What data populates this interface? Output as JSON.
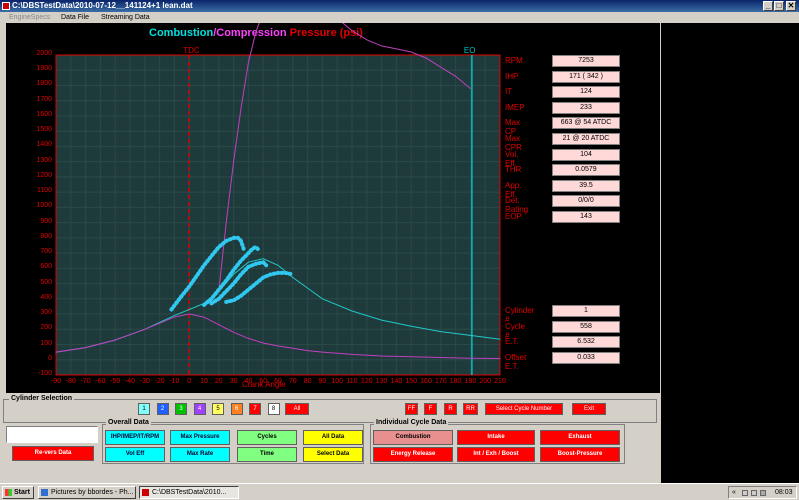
{
  "window": {
    "title": "C:\\DBSTestData\\2010-07-12__141124+1 lean.dat",
    "minimize": "_",
    "maximize": "□",
    "close": "✕"
  },
  "menu": {
    "items": [
      {
        "label": "EngineSpecs",
        "disabled": true
      },
      {
        "label": "Data File",
        "disabled": false
      },
      {
        "label": "Streaming Data",
        "disabled": false
      }
    ]
  },
  "chart": {
    "title_part1": "Combustion",
    "title_sep": "/",
    "title_part2": "Compression",
    "title_part3": "Pressure (psi)",
    "marker_tdc": "TDC",
    "marker_eo": "EO",
    "xlabel": "Crank Angle"
  },
  "colors": {
    "title_cyan": "#00e0e0",
    "title_magenta": "#ff40ff",
    "axis_red": "#e00000",
    "grid": "#2a4a4a",
    "plot_bg": "#1f3a3a",
    "combustion_trace": "#20c8c8",
    "compression_trace": "#c040c0",
    "highlight": "#30c8f0",
    "readout_bg": "#ffd8d8"
  },
  "chart_data": {
    "type": "line",
    "xlabel": "Crank Angle",
    "ylabel": "",
    "xlim": [
      -90,
      210
    ],
    "ylim": [
      -100,
      2000
    ],
    "x_ticks": [
      -90,
      -80,
      -70,
      -60,
      -50,
      -40,
      -30,
      -20,
      -10,
      0,
      10,
      20,
      30,
      40,
      50,
      60,
      70,
      80,
      90,
      100,
      110,
      120,
      130,
      140,
      150,
      160,
      170,
      180,
      190,
      200,
      210
    ],
    "y_ticks": [
      2000,
      1900,
      1800,
      1700,
      1600,
      1500,
      1400,
      1300,
      1200,
      1100,
      1000,
      900,
      800,
      700,
      600,
      500,
      400,
      300,
      200,
      100,
      0,
      -100
    ],
    "markers": [
      {
        "label": "TDC",
        "x": 0
      },
      {
        "label": "EO",
        "x": 191
      }
    ],
    "series": [
      {
        "key": "combustion",
        "x": [
          -90,
          -70,
          -50,
          -30,
          -10,
          0,
          10,
          20,
          30,
          40,
          50,
          60,
          70,
          80,
          90,
          110,
          130,
          150,
          170,
          190,
          210
        ],
        "y": [
          50,
          80,
          130,
          200,
          290,
          330,
          370,
          450,
          560,
          640,
          663,
          620,
          540,
          470,
          400,
          320,
          260,
          220,
          185,
          160,
          135
        ]
      },
      {
        "key": "compression",
        "x": [
          -90,
          -70,
          -50,
          -30,
          -10,
          0,
          10,
          20,
          30,
          40,
          50,
          60,
          70,
          80,
          90,
          110,
          130,
          150,
          170,
          190,
          210
        ],
        "y": [
          50,
          80,
          130,
          200,
          280,
          300,
          280,
          230,
          180,
          140,
          110,
          90,
          75,
          60,
          50,
          35,
          25,
          20,
          15,
          10,
          8
        ]
      },
      {
        "key": "rise_trace",
        "x": [
          20,
          25,
          30,
          35,
          40,
          45,
          50,
          55,
          60,
          70,
          80,
          90,
          100,
          110,
          120,
          130,
          140,
          150,
          160,
          170,
          180,
          190
        ],
        "y": [
          450,
          900,
          1300,
          1650,
          1950,
          2150,
          2280,
          2330,
          2340,
          2350,
          2360,
          2320,
          2240,
          2160,
          2100,
          2060,
          2040,
          2020,
          1980,
          1920,
          1860,
          1780
        ]
      },
      {
        "key": "highlight_1",
        "x": [
          -12,
          -5,
          0,
          5,
          10,
          15,
          20,
          25,
          30,
          33,
          35,
          37
        ],
        "y": [
          330,
          420,
          480,
          550,
          620,
          680,
          740,
          780,
          800,
          800,
          780,
          720
        ]
      },
      {
        "key": "highlight_2",
        "x": [
          10,
          15,
          20,
          25,
          30,
          35,
          40,
          43,
          45,
          47
        ],
        "y": [
          360,
          400,
          460,
          520,
          590,
          650,
          700,
          730,
          740,
          720
        ]
      },
      {
        "key": "highlight_3",
        "x": [
          15,
          20,
          25,
          30,
          35,
          40,
          45,
          50,
          52
        ],
        "y": [
          370,
          400,
          450,
          500,
          560,
          610,
          630,
          640,
          620
        ]
      },
      {
        "key": "highlight_4",
        "x": [
          25,
          30,
          35,
          40,
          45,
          50,
          55,
          60,
          65,
          70
        ],
        "y": [
          380,
          390,
          420,
          460,
          500,
          540,
          560,
          570,
          570,
          560
        ]
      }
    ]
  },
  "readouts_top": [
    {
      "label": "RPM",
      "value": "7253"
    },
    {
      "label": "IHP",
      "value": "171 ( 342 )"
    },
    {
      "label": "IT",
      "value": "124"
    },
    {
      "label": "IMEP",
      "value": "233"
    },
    {
      "label": "Max CP",
      "value": "663 @ 54 ATDC"
    },
    {
      "label": "Max CPR",
      "value": "21 @ 20 ATDC"
    },
    {
      "label": "Vol. Eff.",
      "value": "104"
    },
    {
      "label": "THR",
      "value": "0.0579"
    },
    {
      "label": "App. Eff.",
      "value": "39.5"
    },
    {
      "label": "Det. Rating",
      "value": "0/0/0"
    },
    {
      "label": "EOP",
      "value": "143"
    }
  ],
  "readouts_bottom": [
    {
      "label": "Cylinder #",
      "value": "1"
    },
    {
      "label": "Cycle #",
      "value": "558"
    },
    {
      "label": "E.T.",
      "value": "6.532"
    },
    {
      "label": "Offset E.T.",
      "value": "0.033"
    }
  ],
  "cylinder_selection": {
    "title": "Cylinder Selection",
    "buttons": [
      {
        "label": "1",
        "bg": "#80ffff",
        "fg": "#000"
      },
      {
        "label": "2",
        "bg": "#2060ff",
        "fg": "#fff"
      },
      {
        "label": "3",
        "bg": "#00c000",
        "fg": "#fff"
      },
      {
        "label": "4",
        "bg": "#a040ff",
        "fg": "#fff"
      },
      {
        "label": "5",
        "bg": "#ffff60",
        "fg": "#000"
      },
      {
        "label": "6",
        "bg": "#ff8020",
        "fg": "#fff"
      },
      {
        "label": "7",
        "bg": "#ff0000",
        "fg": "#fff"
      },
      {
        "label": "8",
        "bg": "#ffffff",
        "fg": "#000"
      }
    ],
    "all_label": "All"
  },
  "nav": {
    "ff": "FF",
    "f": "F",
    "r": "R",
    "rr": "RR",
    "select_cycle": "Select Cycle Number",
    "exit": "Exit"
  },
  "left_box": {
    "input_value": "",
    "reverse_label": "Re-vers Data"
  },
  "overall_data": {
    "title": "Overall Data",
    "buttons": [
      "IHP/IMEP/IT/RPM",
      "Max Pressure",
      "Cycles",
      "All Data",
      "Vol Eff",
      "Max Rate",
      "Time",
      "Select Data"
    ]
  },
  "individual_data": {
    "title": "Individual Cycle Data",
    "buttons": [
      "Combustion",
      "Intake",
      "Exhaust",
      "Energy Release",
      "Int / Exh / Boost",
      "Boost-Pressure"
    ]
  },
  "taskbar": {
    "start": "Start",
    "items": [
      "Pictures by bbordes - Ph...",
      "C:\\DBSTestData\\2010..."
    ],
    "tray_arrows": "«",
    "time": "08:03"
  }
}
